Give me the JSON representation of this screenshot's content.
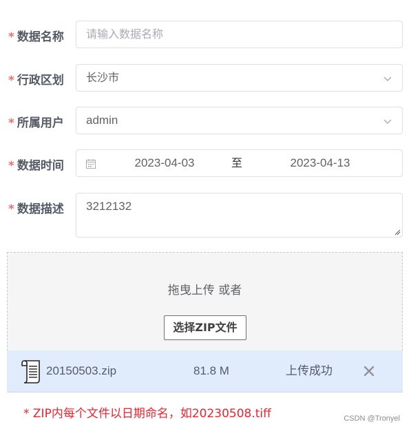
{
  "form": {
    "name": {
      "label": "数据名称",
      "placeholder": "请输入数据名称",
      "value": ""
    },
    "region": {
      "label": "行政区划",
      "value": "长沙市"
    },
    "user": {
      "label": "所属用户",
      "value": "admin"
    },
    "time": {
      "label": "数据时间",
      "start": "2023-04-03",
      "separator": "至",
      "end": "2023-04-13"
    },
    "desc": {
      "label": "数据描述",
      "value": "3212132"
    },
    "required_mark": "*"
  },
  "upload": {
    "hint": "拖曳上传 或者",
    "button_label": "选择ZIP文件"
  },
  "file": {
    "name": "20150503.zip",
    "size": "81.8 M",
    "status": "上传成功"
  },
  "note": "* ZIP内每个文件以日期命名，如20230508.tiff",
  "watermark": "CSDN @Tronyel",
  "colors": {
    "required": "#f56c6c",
    "note": "#f5222d",
    "file_row_bg": "#e0ecfc"
  },
  "icons": {
    "dropdown": "chevron-down-icon",
    "date": "calendar-icon",
    "file": "document-icon",
    "remove": "close-icon"
  }
}
